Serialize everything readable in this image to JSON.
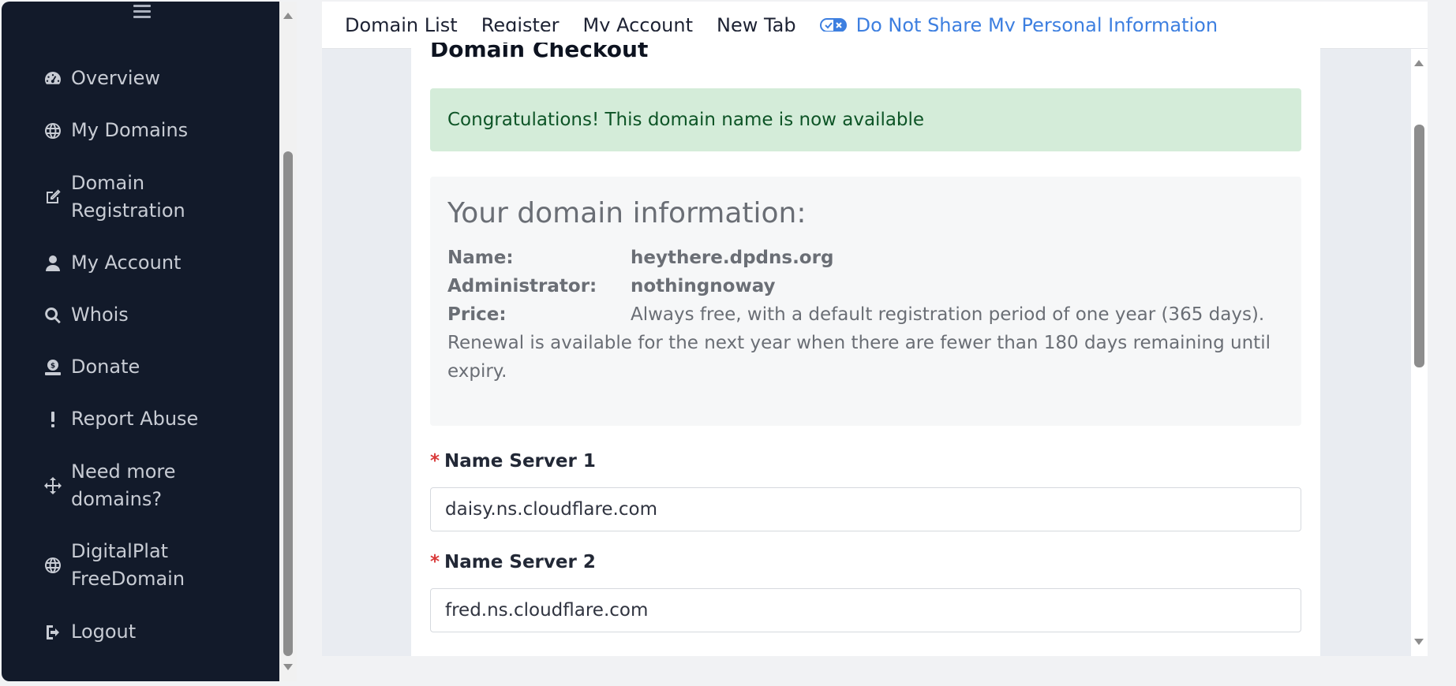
{
  "sidebar": {
    "items": [
      {
        "label": "Overview",
        "icon": "gauge-icon"
      },
      {
        "label": "My Domains",
        "icon": "globe-icon"
      },
      {
        "label": "Domain\nRegistration",
        "icon": "edit-icon"
      },
      {
        "label": "My Account",
        "icon": "user-icon"
      },
      {
        "label": "Whois",
        "icon": "search-icon"
      },
      {
        "label": "Donate",
        "icon": "donate-icon"
      },
      {
        "label": "Report Abuse",
        "icon": "exclamation-icon"
      },
      {
        "label": "Need more\ndomains?",
        "icon": "arrows-move-icon"
      },
      {
        "label": "DigitalPlat\nFreeDomain",
        "icon": "globe-icon"
      },
      {
        "label": "Logout",
        "icon": "logout-icon"
      }
    ]
  },
  "topnav": {
    "links": [
      "Domain List",
      "Register",
      "My Account",
      "New Tab"
    ],
    "privacy": "Do Not Share My Personal Information"
  },
  "main": {
    "title": "Domain Checkout",
    "alert": "Congratulations! This domain name is now available",
    "info": {
      "heading": "Your domain information:",
      "name_label": "Name:",
      "name_value": "heythere.dpdns.org",
      "admin_label": "Administrator:",
      "admin_value": "nothingnoway",
      "price_label": "Price:",
      "price_value": "Always free, with a default registration period of one year (365 days). Renewal is available for the next year when there are fewer than 180 days remaining until expiry."
    },
    "ns1": {
      "label": "Name Server 1",
      "value": "daisy.ns.cloudflare.com"
    },
    "ns2": {
      "label": "Name Server 2",
      "value": "fred.ns.cloudflare.com"
    }
  },
  "colors": {
    "sidebar_bg": "#121a2a",
    "accent_link": "#3d7fe0",
    "alert_bg": "#d4ecd9",
    "alert_text": "#0d5426",
    "required": "#d93a3a"
  }
}
